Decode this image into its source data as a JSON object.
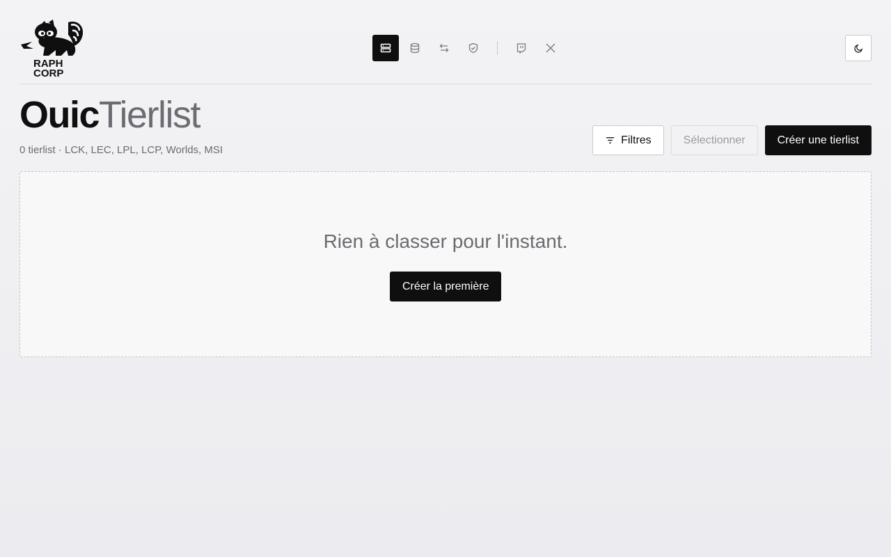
{
  "brand": {
    "logo_line1": "RAPH",
    "logo_line2": "CORP"
  },
  "nav": {
    "items": [
      {
        "icon": "tierlist-icon",
        "active": true
      },
      {
        "icon": "database-icon",
        "active": false
      },
      {
        "icon": "swap-icon",
        "active": false
      },
      {
        "icon": "shield-check-icon",
        "active": false
      },
      {
        "icon": "twitch-icon",
        "active": false
      },
      {
        "icon": "x-icon",
        "active": false
      }
    ],
    "theme_toggle_icon": "moon-icon"
  },
  "page": {
    "title_part1": "Ouic",
    "title_part2": "Tierlist",
    "subtitle": "0 tierlist · LCK, LEC, LPL, LCP, Worlds, MSI"
  },
  "actions": {
    "filters_label": "Filtres",
    "select_label": "Sélectionner",
    "create_label": "Créer une tierlist"
  },
  "empty_state": {
    "message": "Rien à classer pour l'instant.",
    "button_label": "Créer la première"
  },
  "colors": {
    "primary": "#0f0f10",
    "muted": "#6a6a70",
    "border": "#c9c9ce"
  }
}
